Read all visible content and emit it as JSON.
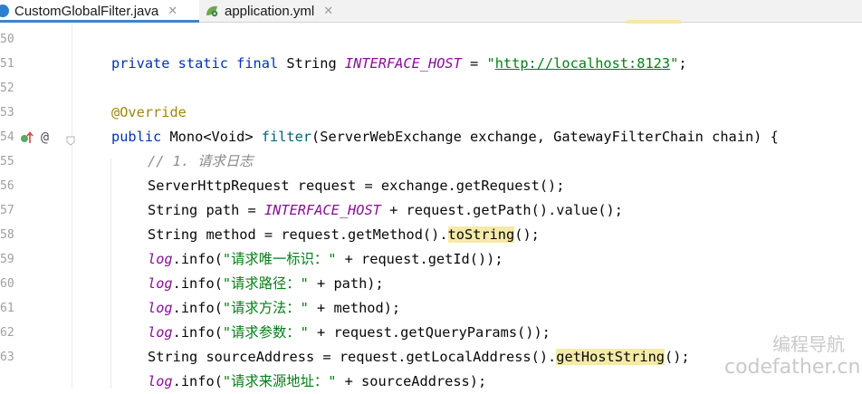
{
  "tabs": [
    {
      "label": "CustomGlobalFilter.java",
      "icon": "java-class-icon",
      "close": "✕"
    },
    {
      "label": "application.yml",
      "icon": "yaml-file-icon",
      "close": "✕"
    }
  ],
  "gutter": {
    "line_numbers": [
      "50",
      "51",
      "52",
      "53",
      "54",
      "55",
      "56",
      "57",
      "58",
      "59",
      "60",
      "61",
      "62",
      "63"
    ],
    "override_marker": "@"
  },
  "code": {
    "l51": {
      "kw": "private static final",
      "type": " String ",
      "const": "INTERFACE_HOST",
      "eq": " = ",
      "q1": "\"",
      "url": "http://localhost:8123",
      "q2": "\"",
      "end": ";"
    },
    "l53": {
      "annotation": "@Override"
    },
    "l54": {
      "kw": "public",
      "a": " Mono<Void> ",
      "fn": "filter",
      "b": "(ServerWebExchange exchange, GatewayFilterChain chain) {"
    },
    "l55": {
      "comment": "// 1. 请求日志"
    },
    "l56": {
      "text": "ServerHttpRequest request = exchange.getRequest();"
    },
    "l57": {
      "a": "String path = ",
      "const": "INTERFACE_HOST",
      "b": " + request.getPath().value();"
    },
    "l58": {
      "a": "String method = request.getMethod().",
      "hl": "toString",
      "b": "();"
    },
    "l59": {
      "field": "log",
      "a": ".info(",
      "str": "\"请求唯一标识：\"",
      "b": " + request.getId());"
    },
    "l60": {
      "field": "log",
      "a": ".info(",
      "str": "\"请求路径：\"",
      "b": " + path);"
    },
    "l61": {
      "field": "log",
      "a": ".info(",
      "str": "\"请求方法：\"",
      "b": " + method);"
    },
    "l62": {
      "field": "log",
      "a": ".info(",
      "str": "\"请求参数：\"",
      "b": " + request.getQueryParams());"
    },
    "l63": {
      "a": "String sourceAddress = request.getLocalAddress().",
      "hl": "getHostString",
      "b": "();"
    },
    "l64": {
      "field": "log",
      "a": ".info(",
      "str": "\"请求来源地址：\"",
      "b": " + sourceAddress);"
    }
  },
  "watermark": {
    "title": "编程导航",
    "url": "codefather.cn"
  },
  "colors": {
    "keyword": "#0033b3",
    "constant": "#871094",
    "string": "#067d17",
    "annotation": "#9e880d",
    "comment": "#8c8c8c",
    "highlight": "#f5eaa9"
  }
}
